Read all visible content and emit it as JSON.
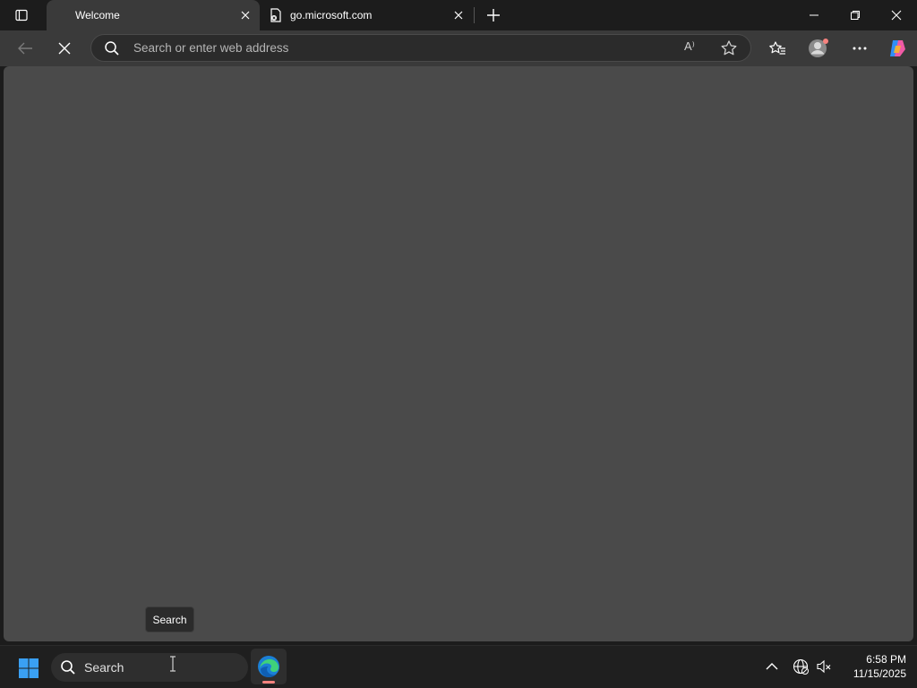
{
  "browser": {
    "tabs": [
      {
        "title": "Welcome",
        "active": true
      },
      {
        "title": "go.microsoft.com",
        "active": false
      }
    ],
    "address_bar": {
      "placeholder": "Search or enter web address"
    },
    "read_aloud_glyph": "A⁾"
  },
  "tooltip": {
    "text": "Search"
  },
  "taskbar": {
    "search_label": "Search",
    "clock": {
      "time": "6:58 PM",
      "date": "11/15/2025"
    }
  },
  "colors": {
    "content_bg": "#4a4a4a",
    "toolbar_bg": "#3a3a3a",
    "taskbar_bg": "#1f1f1f",
    "windows_blue": "#3aa0f3",
    "edge_indicator": "#f6837f"
  },
  "icons": [
    "tab-actions-icon",
    "close-icon",
    "new-tab-icon",
    "minimize-icon",
    "restore-icon",
    "back-icon",
    "stop-loading-icon",
    "search-icon",
    "read-aloud-icon",
    "favorite-star-icon",
    "favorites-icon",
    "profile-icon",
    "more-icon",
    "copilot-icon",
    "windows-start-icon",
    "edge-icon",
    "chevron-up-icon",
    "network-icon",
    "volume-muted-icon"
  ]
}
